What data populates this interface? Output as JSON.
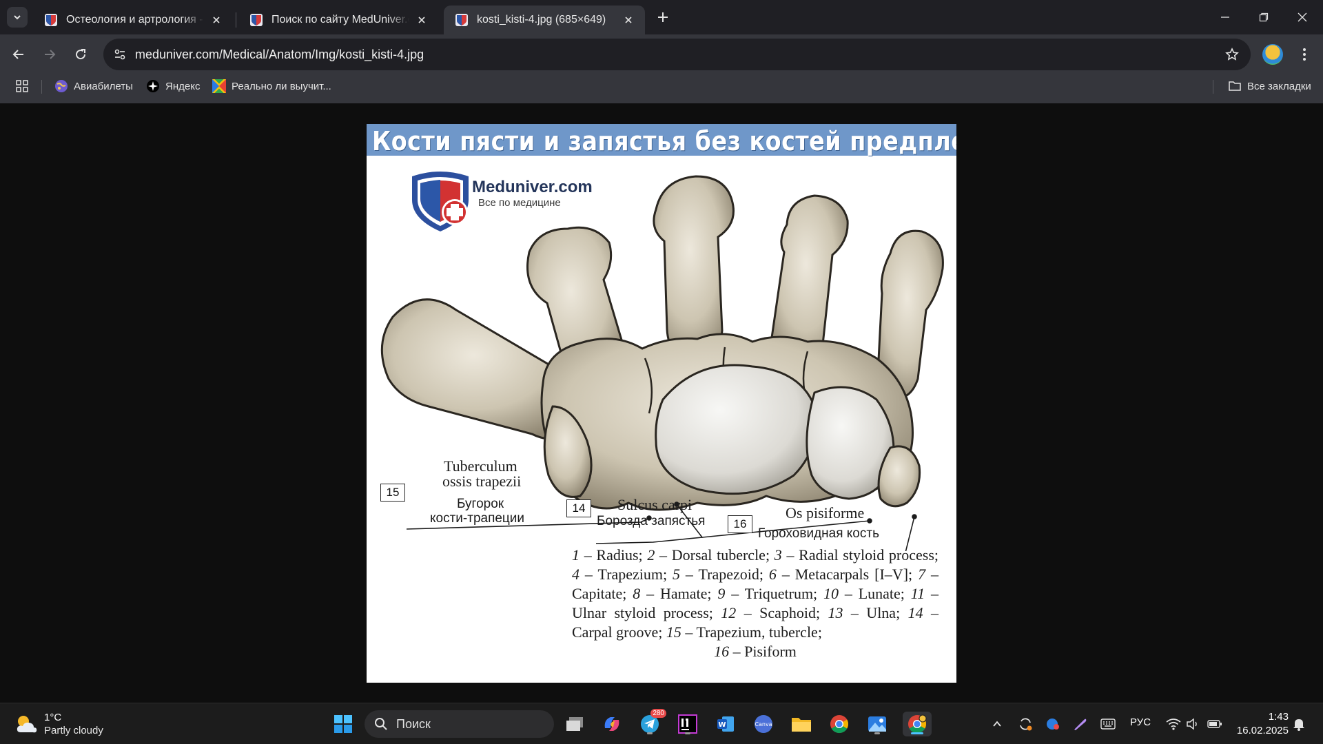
{
  "tabs": [
    {
      "title": "Остеология и артрология - ск",
      "active": false
    },
    {
      "title": "Поиск по сайту MedUniver.com",
      "active": false
    },
    {
      "title": "kosti_kisti-4.jpg (685×649)",
      "active": true
    }
  ],
  "address_bar": {
    "url": "meduniver.com/Medical/Anatom/Img/kosti_kisti-4.jpg"
  },
  "bookmarks": [
    {
      "label": "Авиабилеты",
      "icon": "globe-icon"
    },
    {
      "label": "Яндекс",
      "icon": "yandex-icon"
    },
    {
      "label": "Реально ли выучит...",
      "icon": "colorful-grid-icon"
    }
  ],
  "bookmarks_all": "Все закладки",
  "image": {
    "header": "Кости пясти и запястья без костей предплечья",
    "logo_name": "Meduniver.com",
    "logo_tagline": "Все по медицине",
    "labels": {
      "n15": "15",
      "n14": "14",
      "n16": "16",
      "tuberculum_l1": "Tuberculum",
      "tuberculum_l2": "ossis trapezii",
      "bugorok_l1": "Бугорок",
      "bugorok_l2": "кости-трапеции",
      "sulcus": "Sulcus carpi",
      "borozda": "Борозда запястья",
      "pisiforme": "Os pisiforme",
      "gorokh": "Гороховидная кость"
    },
    "caption": [
      {
        "num": "1",
        "text": " – Radius; "
      },
      {
        "num": "2",
        "text": " – Dorsal tubercle; "
      },
      {
        "num": "3",
        "text": " – Radial styloid process; "
      },
      {
        "num": "4",
        "text": " – Trapezium; "
      },
      {
        "num": "5",
        "text": " – Trapezoid; "
      },
      {
        "num": "6",
        "text": " – Metacarpals [I–V]; "
      },
      {
        "num": "7",
        "text": " – Capitate; "
      },
      {
        "num": "8",
        "text": " – Hamate; "
      },
      {
        "num": "9",
        "text": " – Triquetrum; "
      },
      {
        "num": "10",
        "text": " – Lunate; "
      },
      {
        "num": "11",
        "text": " – Ulnar styloid process; "
      },
      {
        "num": "12",
        "text": " – Scaphoid; "
      },
      {
        "num": "13",
        "text": " – Ulna; "
      },
      {
        "num": "14",
        "text": " – Carpal groove; "
      },
      {
        "num": "15",
        "text": " – Trapezium, tubercle;"
      }
    ],
    "caption_last": {
      "num": "16",
      "text": " – Pisiform"
    }
  },
  "taskbar": {
    "weather_temp": "1°C",
    "weather_cond": "Partly cloudy",
    "search_placeholder": "Поиск",
    "telegram_badge": "280",
    "language": "РУС",
    "time": "1:43",
    "date": "16.02.2025"
  },
  "colors": {
    "tab_bar": "#1f1f24",
    "toolbar": "#35363c",
    "image_header": "#6f97c9",
    "taskbar": "#1c1c1c"
  }
}
